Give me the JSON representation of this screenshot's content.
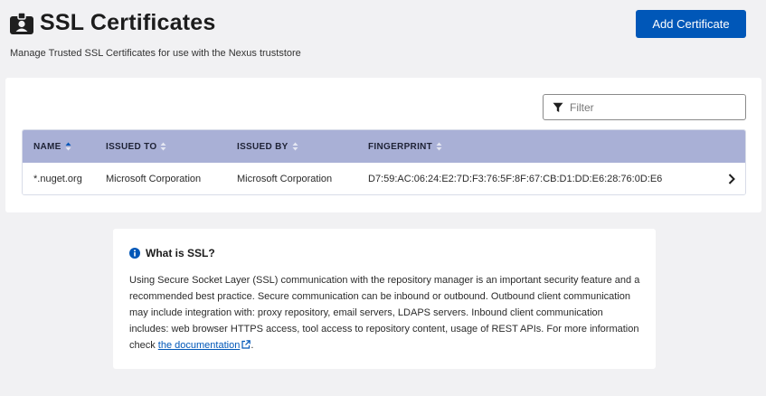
{
  "header": {
    "title": "SSL Certificates",
    "icon": "id-badge-icon",
    "subtitle": "Manage Trusted SSL Certificates for use with the Nexus truststore",
    "add_button_label": "Add Certificate"
  },
  "filter": {
    "placeholder": "Filter",
    "value": "",
    "icon": "filter-icon"
  },
  "table": {
    "columns": [
      {
        "label": "NAME",
        "sort": "ascending"
      },
      {
        "label": "ISSUED TO",
        "sort": "none"
      },
      {
        "label": "ISSUED BY",
        "sort": "none"
      },
      {
        "label": "FINGERPRINT",
        "sort": "none"
      }
    ],
    "rows": [
      {
        "name": "*.nuget.org",
        "issued_to": "Microsoft Corporation",
        "issued_by": "Microsoft Corporation",
        "fingerprint": "D7:59:AC:06:24:E2:7D:F3:76:5F:8F:67:CB:D1:DD:E6:28:76:0D:E6"
      }
    ]
  },
  "info": {
    "title": "What is SSL?",
    "body_prefix": "Using Secure Socket Layer (SSL) communication with the repository manager is an important security feature and a recommended best practice. Secure communication can be inbound or outbound. Outbound client communication may include integration with: proxy repository, email servers, LDAPS servers. Inbound client communication includes: web browser HTTPS access, tool access to repository content, usage of REST APIs. For more information check ",
    "link_text": "the documentation",
    "body_suffix": "."
  },
  "colors": {
    "accent": "#0057b8",
    "table_header": "#a9b0d6",
    "background": "#f1f1f3"
  }
}
